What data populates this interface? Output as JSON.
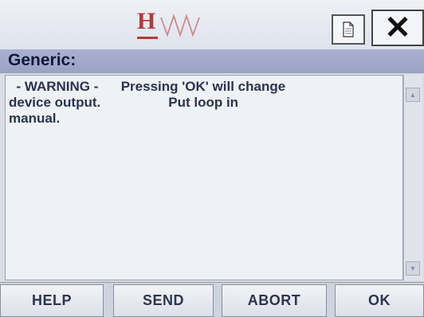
{
  "header": {
    "logo_letter": "H",
    "document_icon": "document-icon",
    "close_label": "✕"
  },
  "dialog": {
    "title": "Generic:",
    "message_line1": "  - WARNING -      Pressing 'OK' will change",
    "message_line2": "device output.                  Put loop in",
    "message_line3": "manual."
  },
  "scrollbar": {
    "up_icon": "▲",
    "down_icon": "▼"
  },
  "buttons": {
    "help": "HELP",
    "send": "SEND",
    "abort": "ABORT",
    "ok": "OK"
  },
  "colors": {
    "logo": "#b23a3a",
    "title_bar": "#9aa2c4",
    "text": "#2a3350"
  }
}
